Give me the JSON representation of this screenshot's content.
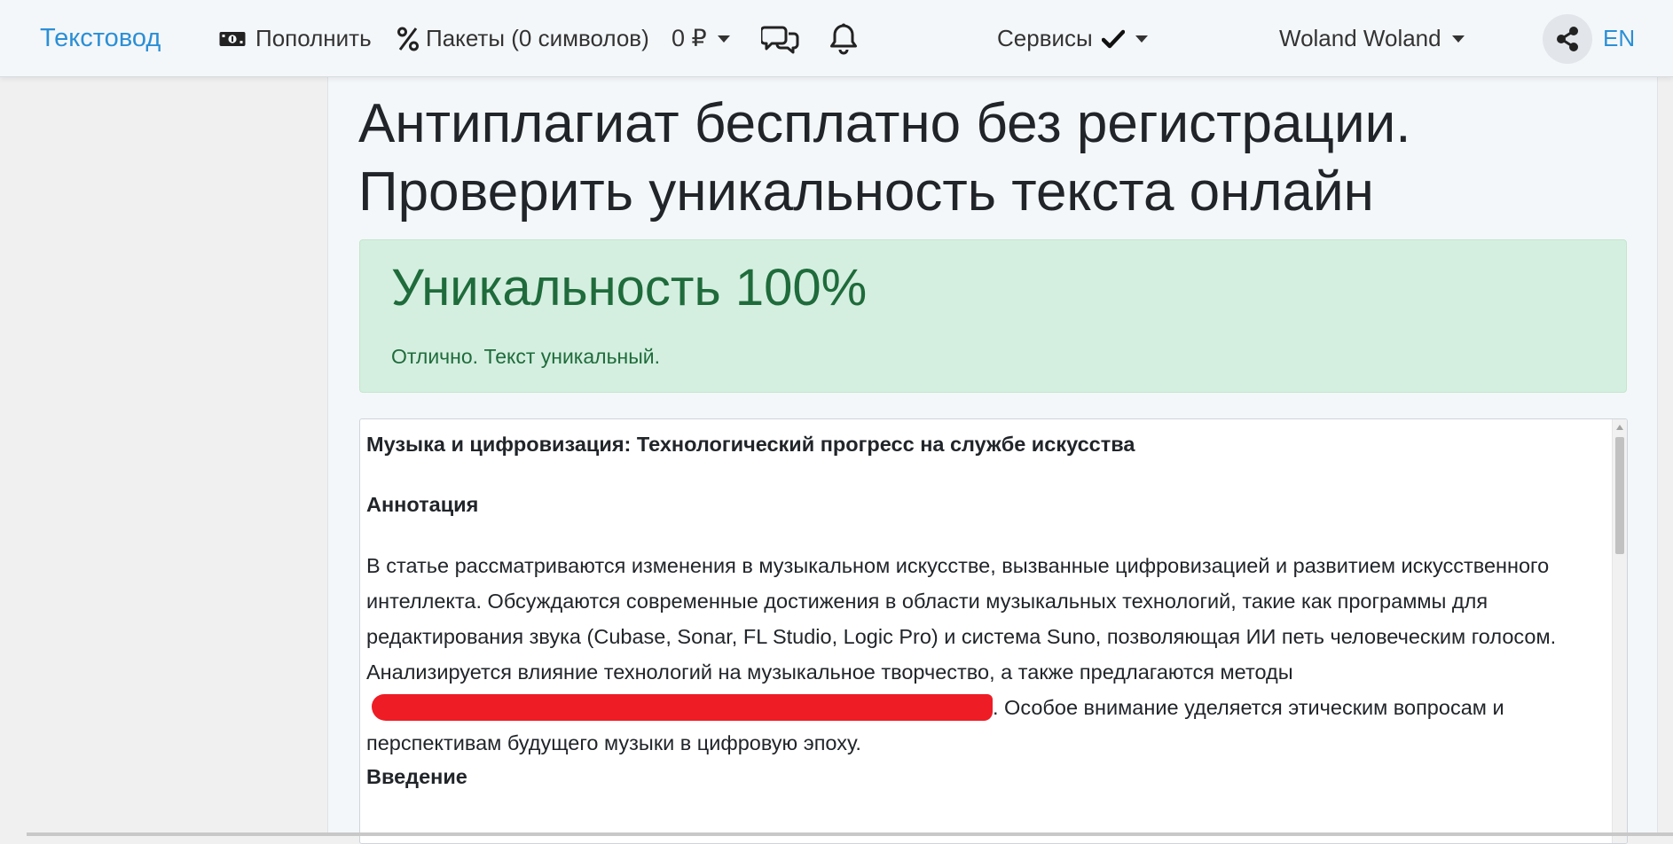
{
  "navbar": {
    "brand": "Текстовод",
    "topup_label": "Пополнить",
    "packages_label": "Пакеты (0 символов)",
    "balance_label": "0 ₽",
    "services_label": "Сервисы",
    "user_name": "Woland Woland",
    "lang_label": "EN"
  },
  "page": {
    "title": "Антиплагиат бесплатно без регистрации. Проверить уникальность текста онлайн"
  },
  "result": {
    "heading": "Уникальность 100%",
    "message": "Отлично. Текст уникальный.",
    "status_color": "#d4efe0",
    "uniqueness_percent": 100
  },
  "document": {
    "title": "Музыка и цифровизация: Технологический прогресс на службе искусства",
    "annotation_heading": "Аннотация",
    "annotation_before_redaction": "В статье рассматриваются изменения в музыкальном искусстве, вызванные цифровизацией и развитием искусственного интеллекта. Обсуждаются современные достижения в области музыкальных технологий, такие как программы для редактирования звука (Cubase, Sonar, FL Studio, Logic Pro) и система Suno, позволяющая ИИ петь человеческим голосом. Анализируется влияние технологий на музыкальное творчество, а также предлагаются методы",
    "annotation_after_redaction": ". Особое внимание уделяется этическим вопросам и перспективам будущего музыки в цифровую эпоху.",
    "intro_heading": "Введение",
    "redaction_color": "#ee1c25"
  },
  "icons": {
    "topup": "cash-icon",
    "packages": "percent-icon",
    "chat": "chat-bubbles-icon",
    "notifications": "bell-icon",
    "services_check": "check-icon",
    "share": "share-icon"
  },
  "colors": {
    "brand": "#2b8fd6",
    "navbar_bg": "#f4f7fa",
    "success_text": "#1f6b3b"
  }
}
